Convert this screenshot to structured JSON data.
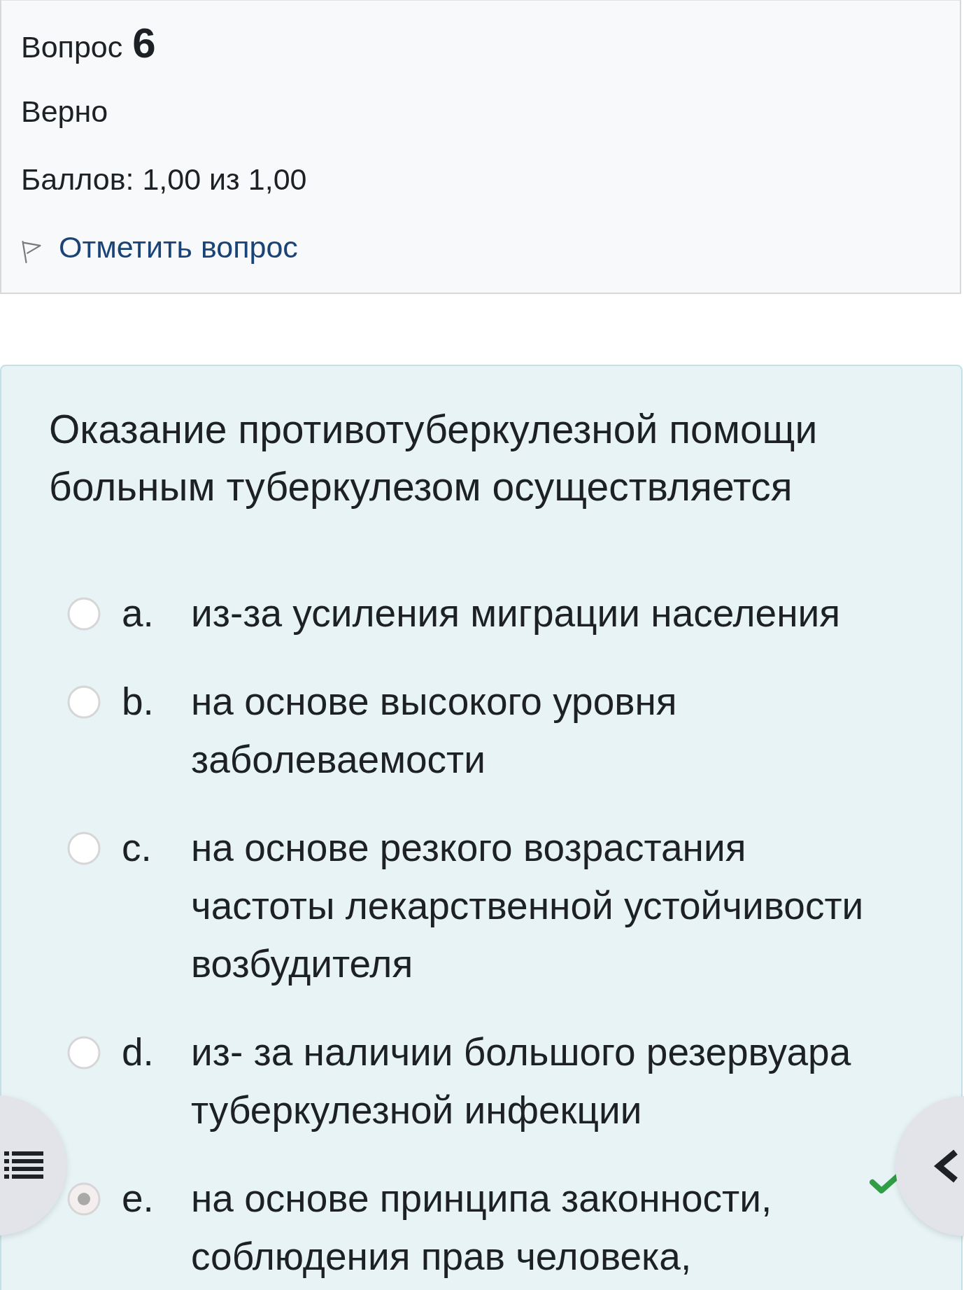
{
  "question_info": {
    "label": "Вопрос",
    "number": "6",
    "state": "Верно",
    "grade": "Баллов: 1,00 из 1,00",
    "flag_link": "Отметить вопрос"
  },
  "question": {
    "text": "Оказание противотуберкулезной помощи больным туберкулезом осуществляется",
    "options": [
      {
        "letter": "a.",
        "text": "из-за усиления миграции населения",
        "selected": false,
        "correct": false
      },
      {
        "letter": "b.",
        "text": "на основе высокого уровня заболеваемости",
        "selected": false,
        "correct": false
      },
      {
        "letter": "c.",
        "text": "на основе резкого возрастания частоты лекарственной устойчивости возбудителя",
        "selected": false,
        "correct": false
      },
      {
        "letter": "d.",
        "text": "из- за наличии большого резервуара туберкулезной инфекции",
        "selected": false,
        "correct": false
      },
      {
        "letter": "e.",
        "text": "на основе принципа законности, соблюдения прав человека,",
        "selected": true,
        "correct": true
      }
    ]
  }
}
